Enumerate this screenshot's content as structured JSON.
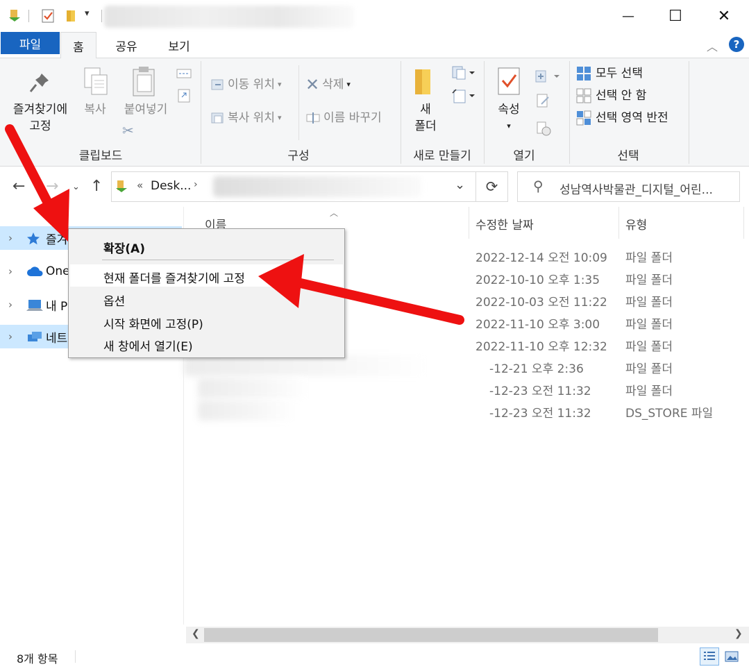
{
  "window": {
    "minimize_glyph": "—",
    "maximize_glyph": "☐",
    "close_glyph": "✕"
  },
  "tabs": [
    {
      "label": "파일"
    },
    {
      "label": "홈"
    },
    {
      "label": "공유"
    },
    {
      "label": "보기"
    }
  ],
  "help_label": "?",
  "ribbon": {
    "clipboard": {
      "pin_label_1": "즐겨찾기에",
      "pin_label_2": "고정",
      "copy_label": "복사",
      "paste_label": "붙여넣기",
      "group_label": "클립보드"
    },
    "organize": {
      "move_to_label": "이동 위치",
      "copy_to_label": "복사 위치",
      "delete_label": "삭제",
      "rename_label": "이름 바꾸기",
      "group_label": "구성"
    },
    "new": {
      "new_folder_label_1": "새",
      "new_folder_label_2": "폴더",
      "group_label": "새로 만들기"
    },
    "open": {
      "properties_label": "속성",
      "group_label": "열기"
    },
    "select": {
      "select_all_label": "모두 선택",
      "select_none_label": "선택 안 함",
      "invert_label": "선택 영역 반전",
      "group_label": "선택"
    }
  },
  "address": {
    "breadcrumb_prefix": "«",
    "breadcrumb_item": "Desk...",
    "search_placeholder": "성남역사박물관_디지털_어린..."
  },
  "navpane": {
    "items": [
      {
        "label": "즐겨찾기",
        "icon": "star-icon",
        "selected": true
      },
      {
        "label": "OneDrive",
        "icon": "onedrive-cloud-icon",
        "selected": false
      },
      {
        "label": "내 PC",
        "icon": "pc-icon",
        "selected": false
      },
      {
        "label": "네트워크",
        "icon": "network-icon",
        "selected": true
      }
    ]
  },
  "filelist": {
    "columns": {
      "name": "이름",
      "date": "수정한 날짜",
      "type": "유형"
    },
    "rows": [
      {
        "date": "2022-12-14 오전 10:09",
        "type": "파일 폴더"
      },
      {
        "date": "2022-10-10 오후 1:35",
        "type": "파일 폴더"
      },
      {
        "date": "2022-10-03 오전 11:22",
        "type": "파일 폴더"
      },
      {
        "date": "2022-11-10 오후 3:00",
        "type": "파일 폴더"
      },
      {
        "date": "2022-11-10 오후 12:32",
        "type": "파일 폴더"
      },
      {
        "date": "-12-21 오후 2:36",
        "type": "파일 폴더"
      },
      {
        "date": "-12-23 오전 11:32",
        "type": "파일 폴더"
      },
      {
        "date": "-12-23 오전 11:32",
        "type": "DS_STORE 파일"
      }
    ]
  },
  "status": {
    "item_count": "8개 항목"
  },
  "context_menu": {
    "items": [
      {
        "label": "확장(A)",
        "bold": true
      },
      {
        "label": "현재 폴더를 즐겨찾기에 고정"
      },
      {
        "label": "옵션"
      },
      {
        "label": "시작 화면에 고정(P)"
      },
      {
        "label": "새 창에서 열기(E)"
      }
    ]
  },
  "colors": {
    "accent": "#1965c0",
    "selection": "#cce8ff",
    "annotation_arrow": "#ee1111"
  }
}
